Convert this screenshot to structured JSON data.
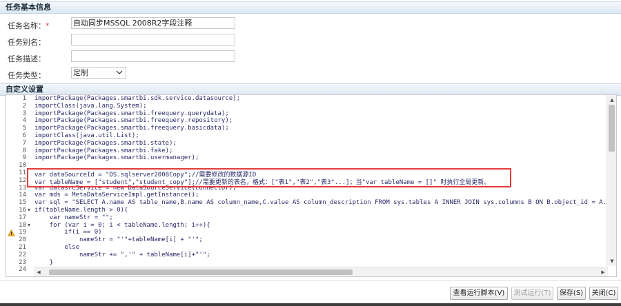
{
  "task_basic": {
    "header": "任务基本信息",
    "name_label": "任务名称：",
    "required_mark": "*",
    "name_value": "自动同步MSSQL 2008R2字段注释",
    "alias_label": "任务别名：",
    "alias_value": "",
    "desc_label": "任务描述：",
    "desc_value": "",
    "type_label": "任务类型：",
    "type_value": "定制"
  },
  "custom": {
    "header": "自定义设置"
  },
  "editor": {
    "lines": [
      {
        "n": "1",
        "text": "importPackage(Packages.smartbi.sdk.service.datasource);"
      },
      {
        "n": "2",
        "text": "importClass(java.lang.System);"
      },
      {
        "n": "3",
        "text": "importPackage(Packages.smartbi.freequery.querydata);"
      },
      {
        "n": "4",
        "text": "importPackage(Packages.smartbi.freequery.repository);"
      },
      {
        "n": "5",
        "text": "importPackage(Packages.smartbi.freequery.basicdata);"
      },
      {
        "n": "6",
        "text": "importClass(java.util.List);"
      },
      {
        "n": "7",
        "text": "importPackage(Packages.smartbi.state);"
      },
      {
        "n": "8",
        "text": "importPackage(Packages.smartbi.fake);"
      },
      {
        "n": "9",
        "text": "importPackage(Packages.smartbi.usermanager);"
      },
      {
        "n": "10",
        "text": ""
      },
      {
        "n": "11",
        "text": "var dataSourceId = \"DS.sqlserver2008Copy\";//需要修改的数据源ID"
      },
      {
        "n": "12",
        "text": "var tableName = [\"student\",\"student_copy\"];//需要更新的表名，格式：[\"表1\",\"表2\",\"表3\"...]；当\"var tableName = []\" 时执行全局更新。"
      },
      {
        "n": "13",
        "text": "var datasrcService = new DataSourceService(connector);"
      },
      {
        "n": "14",
        "text": "var mds = MetaDataServiceImpl.getInstance();"
      },
      {
        "n": "15",
        "text": "var sql = \"SELECT A.name AS table_name,B.name AS column_name,C.value AS column_description FROM sys.tables A INNER JOIN sys.columns B ON B.object_id = A.object_id LEFT JOIN"
      },
      {
        "n": "16",
        "text": "if(tableName.length > 0){"
      },
      {
        "n": "17",
        "text": "    var nameStr = \"\";"
      },
      {
        "n": "18",
        "text": "    for (var i = 0; i < tableName.length; i++){"
      },
      {
        "n": "19",
        "text": "        if(i == 0)"
      },
      {
        "n": "20",
        "text": "            nameStr = \"'\"+tableName[i] + \"'\";"
      },
      {
        "n": "21",
        "text": "        else"
      },
      {
        "n": "22",
        "text": "            nameStr += \",'\" + tableName[i]+\"'\";"
      },
      {
        "n": "23",
        "text": "    }"
      },
      {
        "n": "24",
        "text": ""
      }
    ]
  },
  "buttons": {
    "view_script": "查看运行脚本(V)",
    "test_run": "测试运行(T)",
    "save": "保存(S)",
    "close": "关闭(C)"
  },
  "colors": {
    "header_bg": "#e3ecf5",
    "highlight_border": "#e53a3a",
    "required": "#e03a3a"
  }
}
